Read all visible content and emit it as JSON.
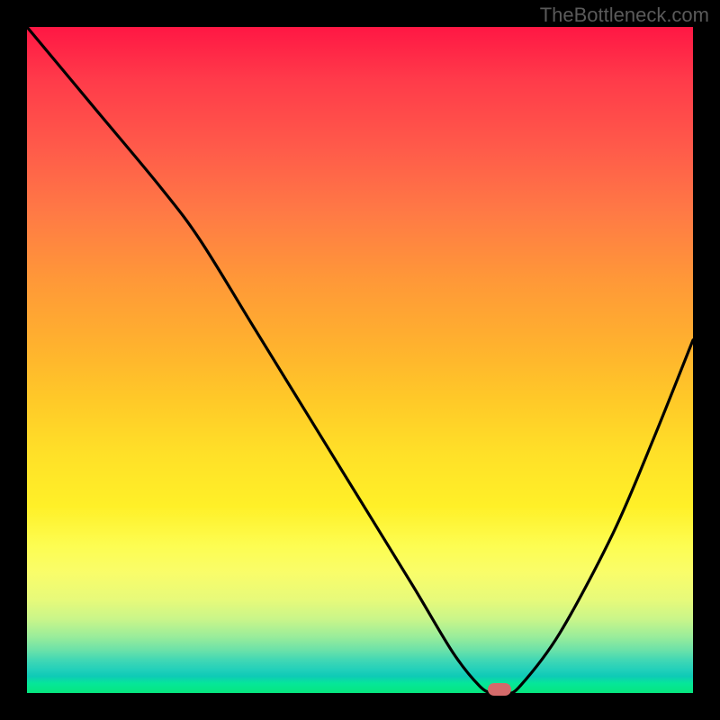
{
  "watermark": "TheBottleneck.com",
  "chart_data": {
    "type": "line",
    "title": "",
    "xlabel": "",
    "ylabel": "",
    "xlim": [
      0,
      100
    ],
    "ylim": [
      0,
      100
    ],
    "series": [
      {
        "name": "curve",
        "x": [
          0,
          10,
          20,
          26,
          34,
          42,
          50,
          58,
          64,
          68,
          70,
          72,
          74,
          80,
          88,
          94,
          100
        ],
        "values": [
          100,
          88,
          76,
          68,
          55,
          42,
          29,
          16,
          6,
          1,
          0,
          0,
          1,
          9,
          24,
          38,
          53
        ]
      }
    ],
    "marker": {
      "x": 71,
      "y": 0.5
    },
    "background_gradient": {
      "top": "#ff1744",
      "mid": "#ffe028",
      "bottom": "#06e67e"
    }
  }
}
